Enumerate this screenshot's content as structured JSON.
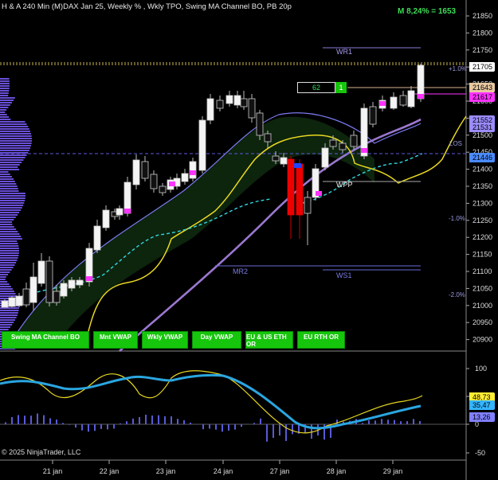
{
  "header": {
    "title": "H & A 240 Min (M)DAX Jan 25, Weekly % , Wkly TPO, Swing MA Channel BO, PB 20p",
    "metric": "M 8,24% = 1653"
  },
  "price_axis": {
    "ticks": [
      "21850",
      "21800",
      "21750",
      "21700",
      "21650",
      "21600",
      "21550",
      "21500",
      "21450",
      "21400",
      "21350",
      "21300",
      "21250",
      "21200",
      "21150",
      "21100",
      "21050",
      "21000",
      "20950",
      "20900"
    ]
  },
  "price_tags": [
    {
      "label": "21705",
      "color": "#ffffff",
      "text": "#000000"
    },
    {
      "label": "21643",
      "color": "#e8c8a0",
      "text": "#000000"
    },
    {
      "label": "21617",
      "color": "#ff33ff",
      "text": "#000000"
    },
    {
      "label": "21552",
      "color": "#9b8cff",
      "text": "#000000"
    },
    {
      "label": "21531",
      "color": "#9b8cff",
      "text": "#000000"
    },
    {
      "label": "21446",
      "color": "#4a8bff",
      "text": "#000000"
    }
  ],
  "chart_labels": {
    "wr1": "WR1",
    "plus1": "+1.0%",
    "los": "LOS",
    "wpp": "WPP",
    "minus1": "-1.0%",
    "mr2": "MR2",
    "ws1": "WS1",
    "minus2": "-2.0%",
    "box_value": "62",
    "box_count": "1"
  },
  "toolbar": [
    {
      "name": "swing-ma-channel-bo-button",
      "label": "Swing MA Channel BO"
    },
    {
      "name": "mnt-vwap-button",
      "label": "Mnt VWAP"
    },
    {
      "name": "wkly-vwap-button",
      "label": "Wkly VWAP"
    },
    {
      "name": "day-vwap-button",
      "label": "Day VWAP"
    },
    {
      "name": "eu-us-eth-or-button",
      "label": "EU & US ETH OR"
    },
    {
      "name": "eu-rth-or-button",
      "label": "EU RTH OR"
    }
  ],
  "oscillator": {
    "ticks": [
      "100",
      "50",
      "0",
      "-50"
    ],
    "tags": [
      {
        "label": "48,73",
        "color": "#ffee33"
      },
      {
        "label": "35,47",
        "color": "#33b5ff"
      },
      {
        "label": "13,26",
        "color": "#8080ff"
      }
    ]
  },
  "time_axis": {
    "labels": [
      "21 jan",
      "22 jan",
      "23 jan",
      "24 jan",
      "27 jan",
      "28 jan",
      "29 jan"
    ]
  },
  "copyright": "© 2025 NinjaTrader, LLC"
}
